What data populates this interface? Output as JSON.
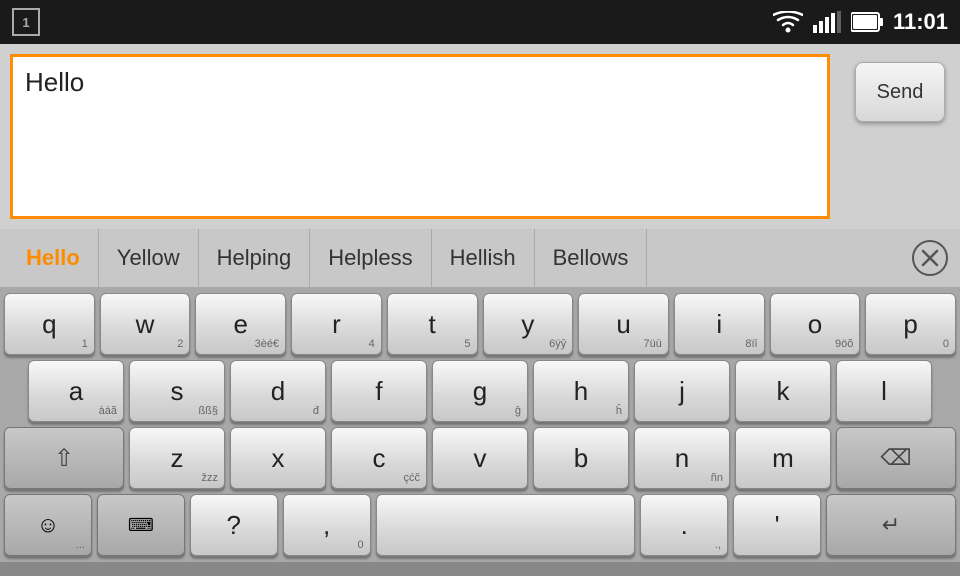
{
  "statusBar": {
    "notificationNumber": "1",
    "time": "11:01"
  },
  "inputArea": {
    "text": "Hello",
    "placeholder": ""
  },
  "sendButton": {
    "label": "Send"
  },
  "suggestions": [
    {
      "label": "Hello",
      "highlight": true
    },
    {
      "label": "Yellow",
      "highlight": false
    },
    {
      "label": "Helping",
      "highlight": false
    },
    {
      "label": "Helpless",
      "highlight": false
    },
    {
      "label": "Hellish",
      "highlight": false
    },
    {
      "label": "Bellows",
      "highlight": false
    }
  ],
  "keyboard": {
    "row1": [
      {
        "main": "q",
        "sub": "1"
      },
      {
        "main": "w",
        "sub": "2"
      },
      {
        "main": "e",
        "sub": "3èé€"
      },
      {
        "main": "r",
        "sub": "4"
      },
      {
        "main": "t",
        "sub": "5"
      },
      {
        "main": "y",
        "sub": "6ÿŷ"
      },
      {
        "main": "u",
        "sub": "7üū"
      },
      {
        "main": "i",
        "sub": "8ïī"
      },
      {
        "main": "o",
        "sub": "9öõ"
      },
      {
        "main": "p",
        "sub": "0"
      }
    ],
    "row2": [
      {
        "main": "a",
        "sub": "àáã"
      },
      {
        "main": "s",
        "sub": "ßß§"
      },
      {
        "main": "d",
        "sub": "đ"
      },
      {
        "main": "f",
        "sub": ""
      },
      {
        "main": "g",
        "sub": "ĝ"
      },
      {
        "main": "h",
        "sub": "ĥ"
      },
      {
        "main": "j",
        "sub": ""
      },
      {
        "main": "k",
        "sub": ""
      },
      {
        "main": "l",
        "sub": ""
      }
    ],
    "row3": [
      {
        "main": "z",
        "sub": "žzz"
      },
      {
        "main": "x",
        "sub": ""
      },
      {
        "main": "c",
        "sub": "çćč"
      },
      {
        "main": "v",
        "sub": ""
      },
      {
        "main": "b",
        "sub": ""
      },
      {
        "main": "n",
        "sub": "ñn"
      },
      {
        "main": "m",
        "sub": ""
      }
    ],
    "row4": {
      "emoji": "☺",
      "emojiSub": "...",
      "kbSub": "",
      "questionMark": "?",
      "questionSub": "",
      "commaSub": "0",
      "spaceSub": "",
      "periodSub": ".,",
      "apostrophe": "'",
      "apostropheSub": ""
    }
  }
}
